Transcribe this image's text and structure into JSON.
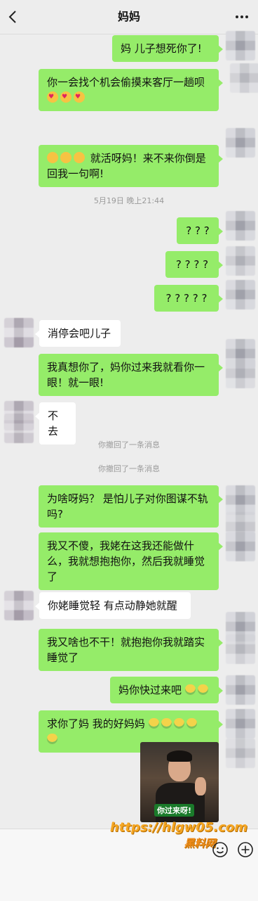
{
  "header": {
    "title": "妈妈"
  },
  "messages": [
    {
      "side": "me",
      "text": "妈 儿子想死你了!"
    },
    {
      "side": "me",
      "text": "你一会找个机会偷摸来客厅一趟呗"
    },
    {
      "side": "me",
      "text": "就活呀妈！来不来你倒是回我一句啊!"
    },
    {
      "side": "me",
      "text": "? ? ?"
    },
    {
      "side": "me",
      "text": "? ? ? ?"
    },
    {
      "side": "me",
      "text": "? ? ? ? ?"
    },
    {
      "side": "them",
      "text": "消停会吧儿子"
    },
    {
      "side": "me",
      "text": "我真想你了，妈你过来我就看你一眼！就一眼!"
    },
    {
      "side": "them",
      "text": "不去"
    },
    {
      "side": "me",
      "text": "为啥呀妈？ 是怕儿子对你图谋不轨吗?"
    },
    {
      "side": "me",
      "text": "我又不傻，我姥在这我还能做什么，我就想抱抱你，然后我就睡觉了"
    },
    {
      "side": "them",
      "text": "你姥睡觉轻 有点动静她就醒"
    },
    {
      "side": "me",
      "text": "我又啥也不干！就抱抱你我就踏实睡觉了"
    },
    {
      "side": "me",
      "text": "妈你快过来吧"
    },
    {
      "side": "me",
      "text": "求你了妈 我的好妈妈"
    }
  ],
  "timestamp": "5月19日 晚上21:44",
  "recalled": [
    "你撤回了一条消息",
    "你撤回了一条消息"
  ],
  "sticker_caption": "你过来呀!",
  "watermark": {
    "line1": "https://hlgw05.com",
    "line2": "黑料网"
  },
  "icons": [
    "back-arrow-icon",
    "more-icon",
    "emoji-icon",
    "plus-icon"
  ]
}
